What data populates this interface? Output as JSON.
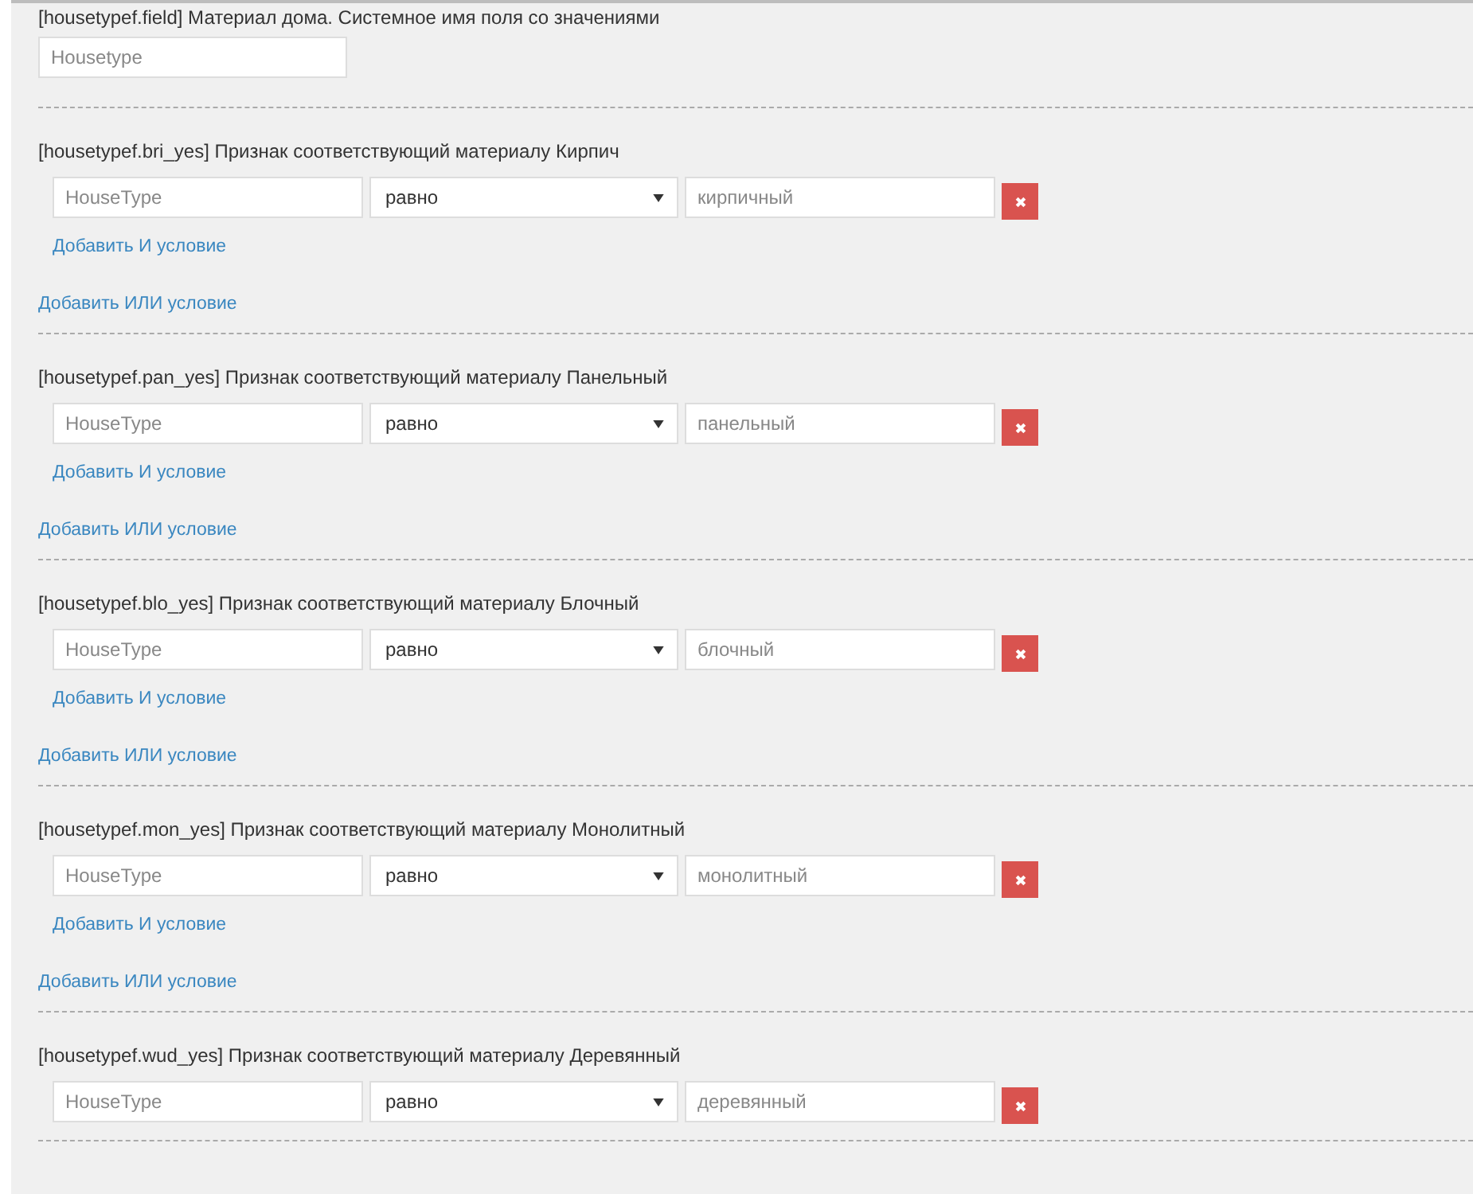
{
  "header": {
    "label": "[housetypef.field] Материал дома. Системное имя поля со значениями",
    "field": {
      "placeholder": "Housetype"
    }
  },
  "conditions": [
    {
      "label": "[housetypef.bri_yes] Признак соответствующий материалу Кирпич",
      "rules": [
        {
          "field_placeholder": "HouseType",
          "operator": "равно",
          "value_placeholder": "кирпичный"
        }
      ],
      "add_and": "Добавить И условие",
      "add_or": "Добавить ИЛИ условие"
    },
    {
      "label": "[housetypef.pan_yes] Признак соответствующий материалу Панельный",
      "rules": [
        {
          "field_placeholder": "HouseType",
          "operator": "равно",
          "value_placeholder": "панельный"
        }
      ],
      "add_and": "Добавить И условие",
      "add_or": "Добавить ИЛИ условие"
    },
    {
      "label": "[housetypef.blo_yes] Признак соответствующий материалу Блочный",
      "rules": [
        {
          "field_placeholder": "HouseType",
          "operator": "равно",
          "value_placeholder": "блочный"
        }
      ],
      "add_and": "Добавить И условие",
      "add_or": "Добавить ИЛИ условие"
    },
    {
      "label": "[housetypef.mon_yes] Признак соответствующий материалу Монолитный",
      "rules": [
        {
          "field_placeholder": "HouseType",
          "operator": "равно",
          "value_placeholder": "монолитный"
        }
      ],
      "add_and": "Добавить И условие",
      "add_or": "Добавить ИЛИ условие"
    },
    {
      "label": "[housetypef.wud_yes] Признак соответствующий материалу Деревянный",
      "rules": [
        {
          "field_placeholder": "HouseType",
          "operator": "равно",
          "value_placeholder": "деревянный"
        }
      ]
    }
  ]
}
